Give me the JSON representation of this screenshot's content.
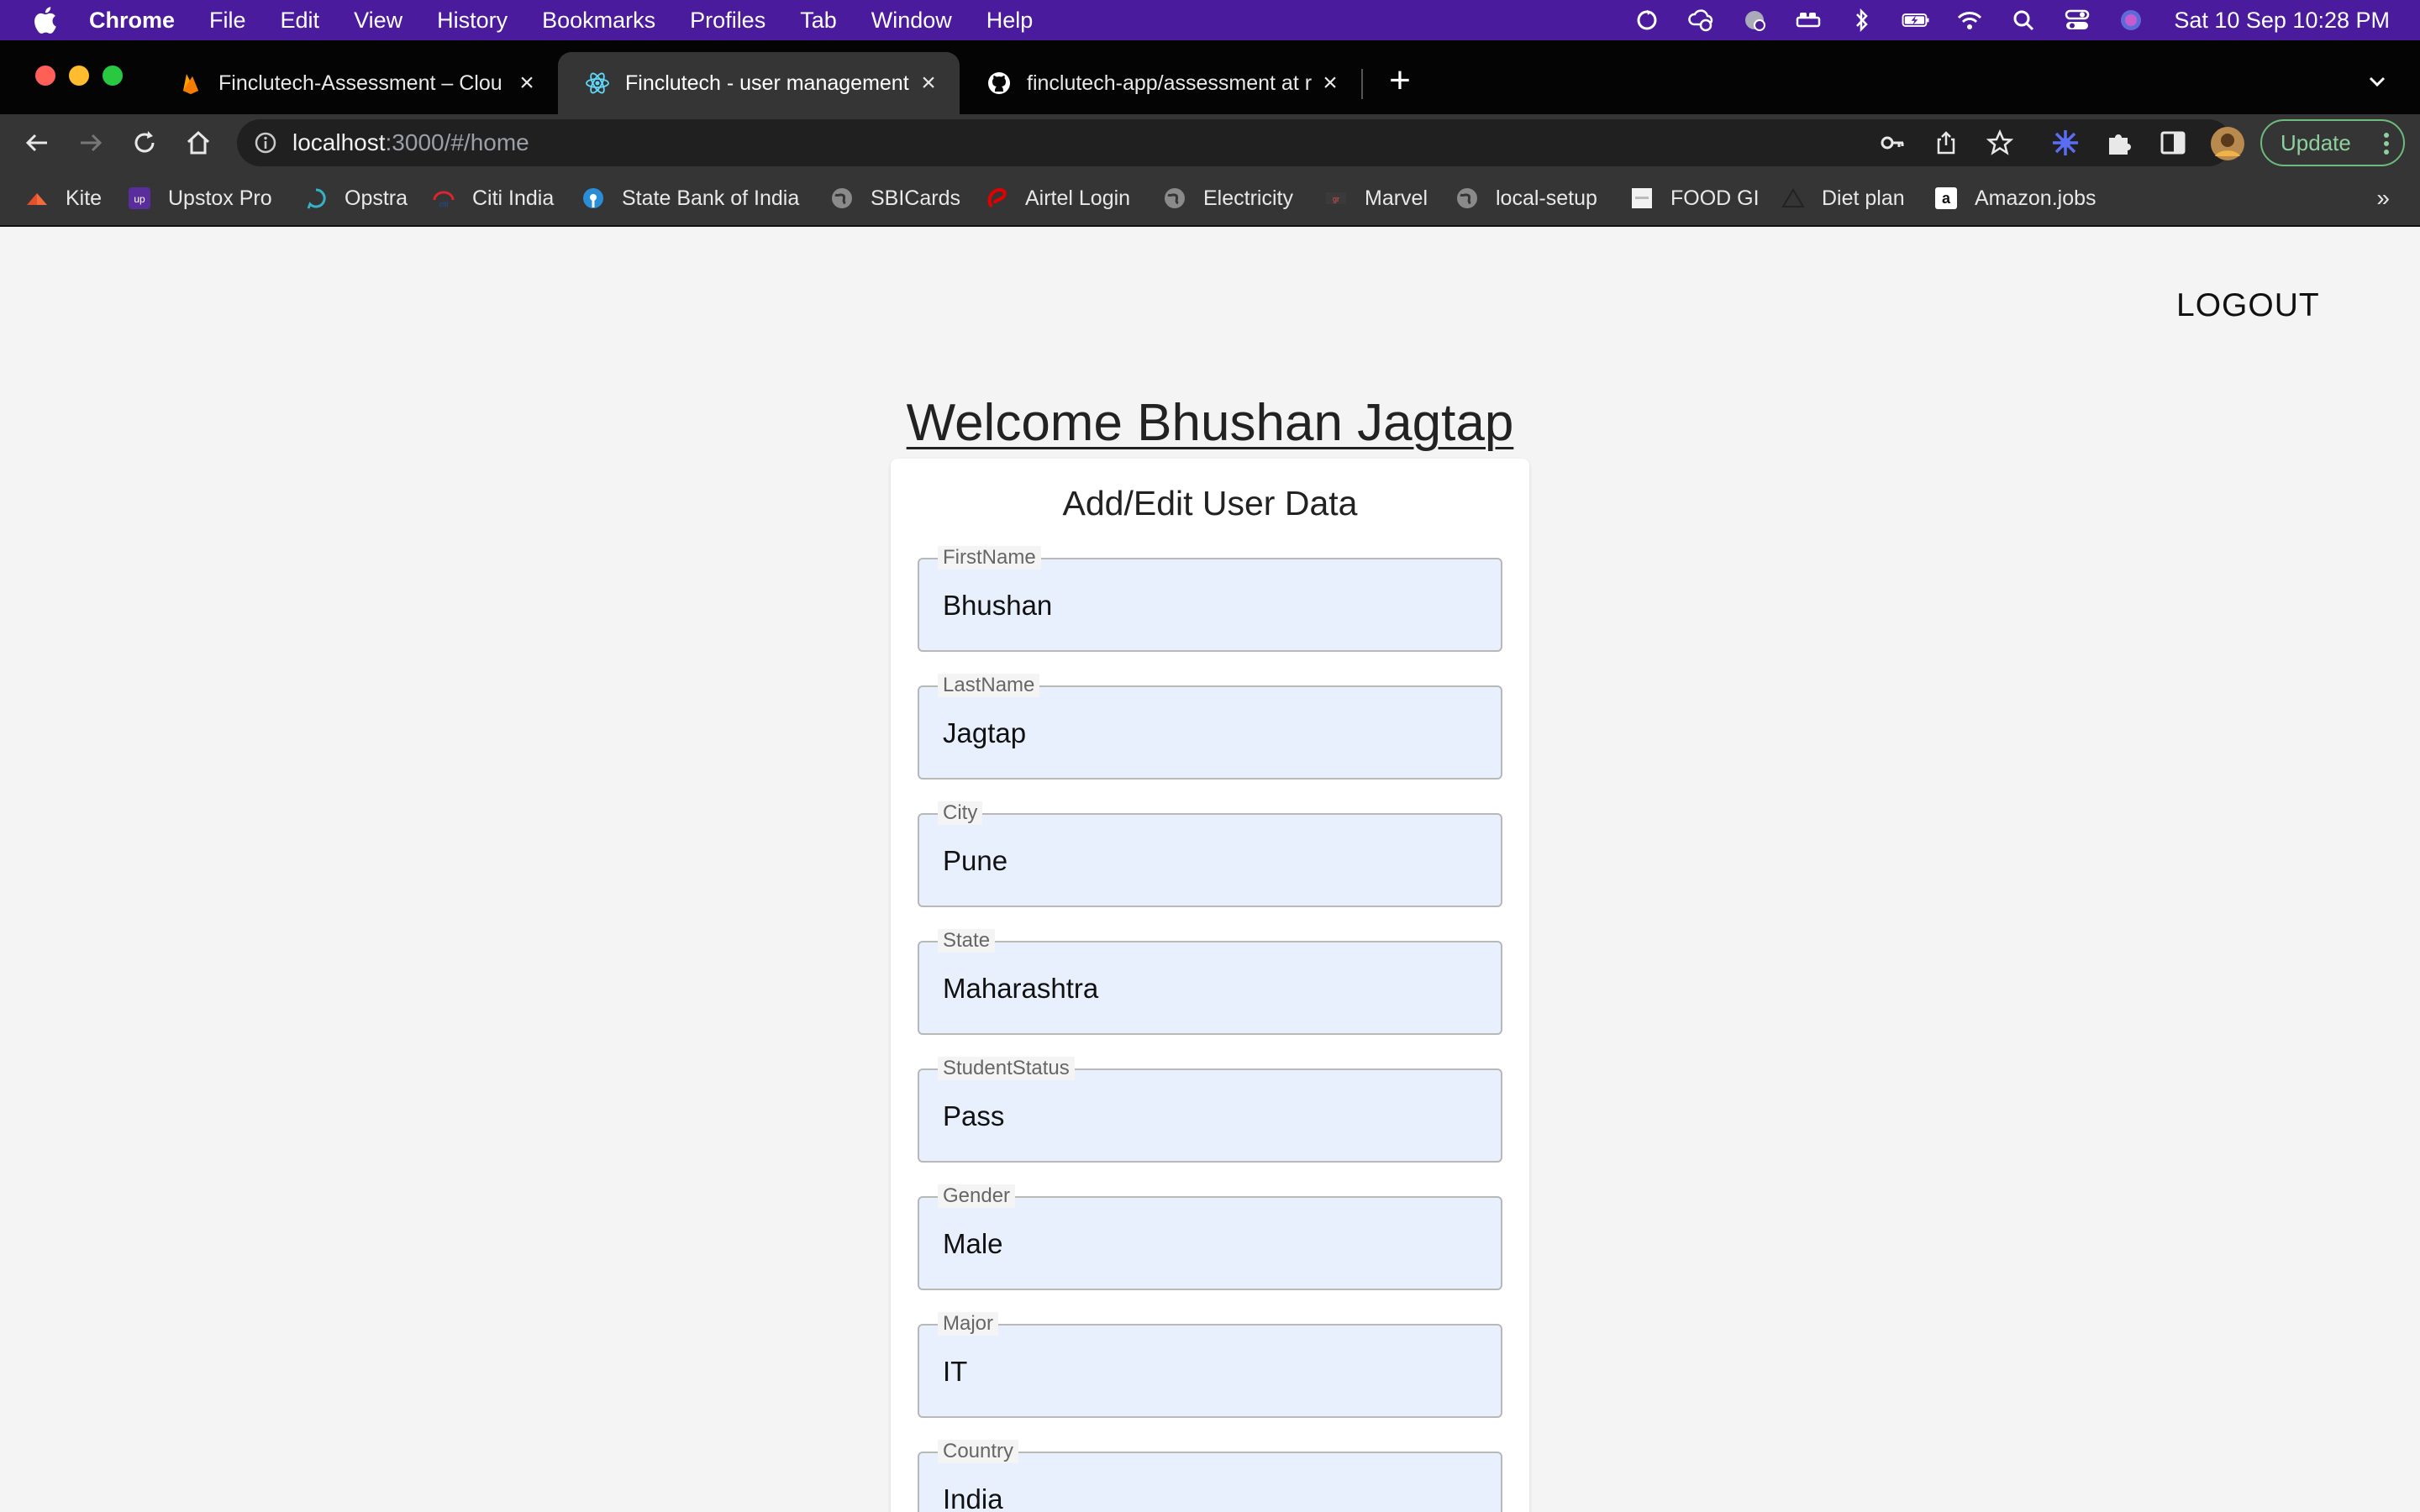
{
  "menubar": {
    "app": "Chrome",
    "items": [
      "File",
      "Edit",
      "View",
      "History",
      "Bookmarks",
      "Profiles",
      "Tab",
      "Window",
      "Help"
    ],
    "clock": "Sat 10 Sep  10:28 PM"
  },
  "tabs": [
    {
      "title": "Finclutech-Assessment – Clou",
      "icon": "firebase-icon"
    },
    {
      "title": "Finclutech - user management",
      "icon": "react-icon"
    },
    {
      "title": "finclutech-app/assessment at r",
      "icon": "github-icon"
    }
  ],
  "toolbar": {
    "url_host": "localhost",
    "url_path": ":3000/#/home",
    "update_label": "Update"
  },
  "bookmarks": [
    {
      "label": "Kite",
      "icon": "kite-icon"
    },
    {
      "label": "Upstox Pro",
      "icon": "upstox-icon"
    },
    {
      "label": "Opstra",
      "icon": "opstra-icon"
    },
    {
      "label": "Citi India",
      "icon": "citi-icon"
    },
    {
      "label": "State Bank of India",
      "icon": "sbi-icon"
    },
    {
      "label": "SBICards",
      "icon": "globe-icon"
    },
    {
      "label": "Airtel Login",
      "icon": "airtel-icon"
    },
    {
      "label": "Electricity",
      "icon": "globe-icon"
    },
    {
      "label": "Marvel",
      "icon": "marvel-icon"
    },
    {
      "label": "local-setup",
      "icon": "globe-icon"
    },
    {
      "label": "FOOD GI",
      "icon": "food-icon"
    },
    {
      "label": "Diet plan",
      "icon": "triangle-icon"
    },
    {
      "label": "Amazon.jobs",
      "icon": "amazon-icon"
    }
  ],
  "page": {
    "logout_label": "LOGOUT",
    "welcome": "Welcome Bhushan Jagtap",
    "form_title": "Add/Edit User Data",
    "fields": [
      {
        "label": "FirstName",
        "value": "Bhushan"
      },
      {
        "label": "LastName",
        "value": "Jagtap"
      },
      {
        "label": "City",
        "value": "Pune"
      },
      {
        "label": "State",
        "value": "Maharashtra"
      },
      {
        "label": "StudentStatus",
        "value": "Pass"
      },
      {
        "label": "Gender",
        "value": "Male"
      },
      {
        "label": "Major",
        "value": "IT"
      },
      {
        "label": "Country",
        "value": "India"
      }
    ]
  },
  "colors": {
    "menubar": "#4a1b9c",
    "tabstrip": "#040404",
    "toolbar": "#353535",
    "field_fill": "#e8f0fe",
    "page_bg": "#f4f4f4"
  }
}
